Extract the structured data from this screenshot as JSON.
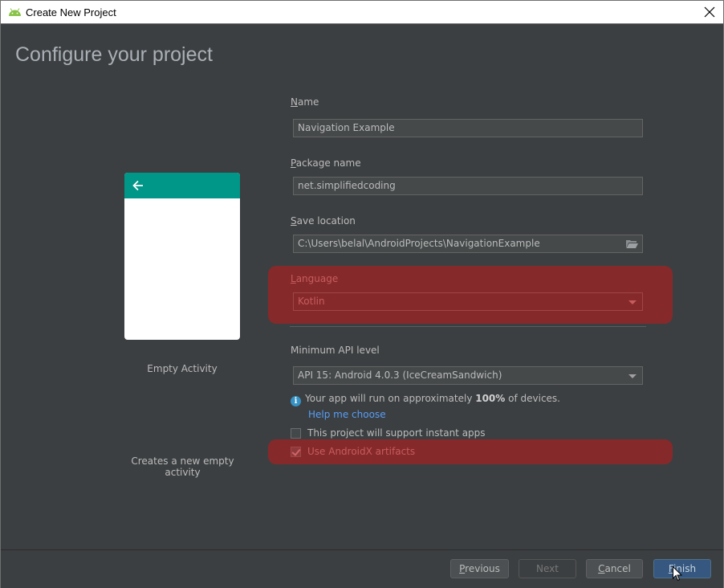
{
  "window": {
    "title": "Create New Project",
    "icon": "android-icon",
    "close_icon": "close-icon"
  },
  "page": {
    "heading": "Configure your project"
  },
  "template": {
    "name": "Empty Activity",
    "description": "Creates a new empty activity",
    "preview_colors": {
      "toolbar": "#009688",
      "body": "#ffffff"
    }
  },
  "form": {
    "name": {
      "label_mnemonic": "N",
      "label_rest": "ame",
      "value": "Navigation Example"
    },
    "package": {
      "label_mnemonic": "P",
      "label_rest": "ackage name",
      "value": "net.simplifiedcoding"
    },
    "save_location": {
      "label_mnemonic": "S",
      "label_rest": "ave location",
      "value": "C:\\Users\\belal\\AndroidProjects\\NavigationExample",
      "browse_icon": "folder-open-icon"
    },
    "language": {
      "label_mnemonic": "L",
      "label_rest": "anguage",
      "value": "Kotlin"
    },
    "min_api": {
      "label": "Minimum API level",
      "value": "API 15: Android 4.0.3 (IceCreamSandwich)"
    },
    "info": {
      "prefix": "Your app will run on approximately ",
      "percent": "100%",
      "suffix": " of devices."
    },
    "help_link": "Help me choose",
    "instant_apps": {
      "label": "This project will support instant apps",
      "checked": false
    },
    "androidx": {
      "label": "Use AndroidX artifacts",
      "checked": true
    }
  },
  "highlight_color": "#86292b",
  "buttons": {
    "previous": {
      "mnemonic": "P",
      "rest": "revious",
      "enabled": true
    },
    "next": {
      "label": "Next",
      "enabled": false
    },
    "cancel": {
      "mnemonic": "C",
      "rest": "ancel",
      "enabled": true
    },
    "finish": {
      "mnemonic": "F",
      "rest": "inish",
      "enabled": true,
      "primary": true
    }
  }
}
